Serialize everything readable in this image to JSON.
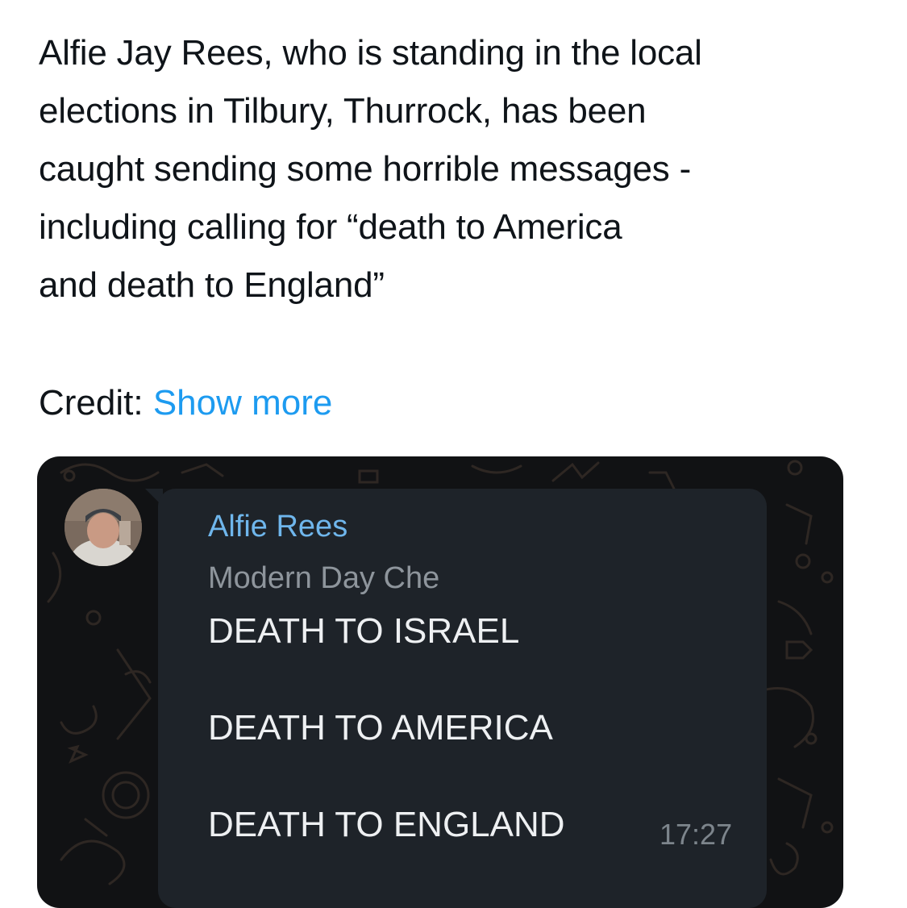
{
  "tweet": {
    "text_lines": [
      "Alfie Jay Rees, who is standing in the local",
      "elections in Tilbury, Thurrock, has been",
      "caught sending some horrible messages -",
      "including calling for “death to America",
      "and death to England”"
    ],
    "credit_label": "Credit:",
    "show_more_label": "Show more",
    "link_color": "#1d9bf0"
  },
  "media": {
    "chat": {
      "sender_name": "Alfie Rees",
      "sender_status": "Modern Day Che",
      "messages": [
        "DEATH TO ISRAEL",
        "DEATH TO AMERICA",
        "DEATH TO ENGLAND"
      ],
      "time": "17:27",
      "sender_color": "#6fb6ec",
      "bubble_color": "#1e2329"
    },
    "avatar_icon": "profile-photo",
    "background_pattern": "doodle-wallpaper"
  }
}
